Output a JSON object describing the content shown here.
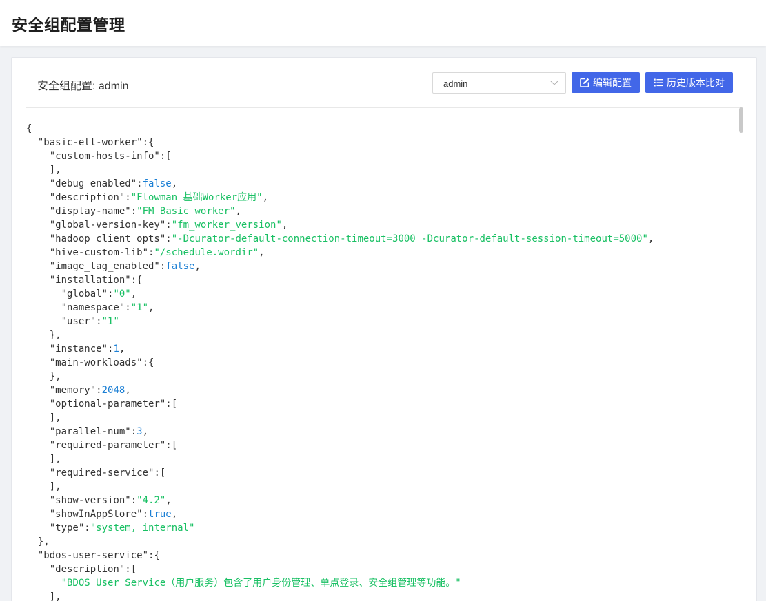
{
  "header": {
    "title": "安全组配置管理"
  },
  "card": {
    "label": "安全组配置: admin",
    "select": {
      "value": "admin"
    },
    "buttons": {
      "edit": "编辑配置",
      "history": "历史版本比对"
    }
  },
  "colors": {
    "accent": "#4267e8",
    "string": "#1ac064",
    "number": "#1b7fd4"
  },
  "code_lines": [
    [
      {
        "t": "p",
        "v": "{"
      }
    ],
    [
      {
        "t": "p",
        "v": "  "
      },
      {
        "t": "k",
        "v": "\"basic-etl-worker\""
      },
      {
        "t": "p",
        "v": ":{"
      }
    ],
    [
      {
        "t": "p",
        "v": "    "
      },
      {
        "t": "k",
        "v": "\"custom-hosts-info\""
      },
      {
        "t": "p",
        "v": ":["
      }
    ],
    [
      {
        "t": "p",
        "v": "    ],"
      }
    ],
    [
      {
        "t": "p",
        "v": "    "
      },
      {
        "t": "k",
        "v": "\"debug_enabled\""
      },
      {
        "t": "p",
        "v": ":"
      },
      {
        "t": "n",
        "v": "false"
      },
      {
        "t": "p",
        "v": ","
      }
    ],
    [
      {
        "t": "p",
        "v": "    "
      },
      {
        "t": "k",
        "v": "\"description\""
      },
      {
        "t": "p",
        "v": ":"
      },
      {
        "t": "s",
        "v": "\"Flowman 基础Worker应用\""
      },
      {
        "t": "p",
        "v": ","
      }
    ],
    [
      {
        "t": "p",
        "v": "    "
      },
      {
        "t": "k",
        "v": "\"display-name\""
      },
      {
        "t": "p",
        "v": ":"
      },
      {
        "t": "s",
        "v": "\"FM Basic worker\""
      },
      {
        "t": "p",
        "v": ","
      }
    ],
    [
      {
        "t": "p",
        "v": "    "
      },
      {
        "t": "k",
        "v": "\"global-version-key\""
      },
      {
        "t": "p",
        "v": ":"
      },
      {
        "t": "s",
        "v": "\"fm_worker_version\""
      },
      {
        "t": "p",
        "v": ","
      }
    ],
    [
      {
        "t": "p",
        "v": "    "
      },
      {
        "t": "k",
        "v": "\"hadoop_client_opts\""
      },
      {
        "t": "p",
        "v": ":"
      },
      {
        "t": "s",
        "v": "\"-Dcurator-default-connection-timeout=3000 -Dcurator-default-session-timeout=5000\""
      },
      {
        "t": "p",
        "v": ","
      }
    ],
    [
      {
        "t": "p",
        "v": "    "
      },
      {
        "t": "k",
        "v": "\"hive-custom-lib\""
      },
      {
        "t": "p",
        "v": ":"
      },
      {
        "t": "s",
        "v": "\"/schedule.wordir\""
      },
      {
        "t": "p",
        "v": ","
      }
    ],
    [
      {
        "t": "p",
        "v": "    "
      },
      {
        "t": "k",
        "v": "\"image_tag_enabled\""
      },
      {
        "t": "p",
        "v": ":"
      },
      {
        "t": "n",
        "v": "false"
      },
      {
        "t": "p",
        "v": ","
      }
    ],
    [
      {
        "t": "p",
        "v": "    "
      },
      {
        "t": "k",
        "v": "\"installation\""
      },
      {
        "t": "p",
        "v": ":{"
      }
    ],
    [
      {
        "t": "p",
        "v": "      "
      },
      {
        "t": "k",
        "v": "\"global\""
      },
      {
        "t": "p",
        "v": ":"
      },
      {
        "t": "s",
        "v": "\"0\""
      },
      {
        "t": "p",
        "v": ","
      }
    ],
    [
      {
        "t": "p",
        "v": "      "
      },
      {
        "t": "k",
        "v": "\"namespace\""
      },
      {
        "t": "p",
        "v": ":"
      },
      {
        "t": "s",
        "v": "\"1\""
      },
      {
        "t": "p",
        "v": ","
      }
    ],
    [
      {
        "t": "p",
        "v": "      "
      },
      {
        "t": "k",
        "v": "\"user\""
      },
      {
        "t": "p",
        "v": ":"
      },
      {
        "t": "s",
        "v": "\"1\""
      }
    ],
    [
      {
        "t": "p",
        "v": "    },"
      }
    ],
    [
      {
        "t": "p",
        "v": "    "
      },
      {
        "t": "k",
        "v": "\"instance\""
      },
      {
        "t": "p",
        "v": ":"
      },
      {
        "t": "n",
        "v": "1"
      },
      {
        "t": "p",
        "v": ","
      }
    ],
    [
      {
        "t": "p",
        "v": "    "
      },
      {
        "t": "k",
        "v": "\"main-workloads\""
      },
      {
        "t": "p",
        "v": ":{"
      }
    ],
    [
      {
        "t": "p",
        "v": "    },"
      }
    ],
    [
      {
        "t": "p",
        "v": "    "
      },
      {
        "t": "k",
        "v": "\"memory\""
      },
      {
        "t": "p",
        "v": ":"
      },
      {
        "t": "n",
        "v": "2048"
      },
      {
        "t": "p",
        "v": ","
      }
    ],
    [
      {
        "t": "p",
        "v": "    "
      },
      {
        "t": "k",
        "v": "\"optional-parameter\""
      },
      {
        "t": "p",
        "v": ":["
      }
    ],
    [
      {
        "t": "p",
        "v": "    ],"
      }
    ],
    [
      {
        "t": "p",
        "v": "    "
      },
      {
        "t": "k",
        "v": "\"parallel-num\""
      },
      {
        "t": "p",
        "v": ":"
      },
      {
        "t": "n",
        "v": "3"
      },
      {
        "t": "p",
        "v": ","
      }
    ],
    [
      {
        "t": "p",
        "v": "    "
      },
      {
        "t": "k",
        "v": "\"required-parameter\""
      },
      {
        "t": "p",
        "v": ":["
      }
    ],
    [
      {
        "t": "p",
        "v": "    ],"
      }
    ],
    [
      {
        "t": "p",
        "v": "    "
      },
      {
        "t": "k",
        "v": "\"required-service\""
      },
      {
        "t": "p",
        "v": ":["
      }
    ],
    [
      {
        "t": "p",
        "v": "    ],"
      }
    ],
    [
      {
        "t": "p",
        "v": "    "
      },
      {
        "t": "k",
        "v": "\"show-version\""
      },
      {
        "t": "p",
        "v": ":"
      },
      {
        "t": "s",
        "v": "\"4.2\""
      },
      {
        "t": "p",
        "v": ","
      }
    ],
    [
      {
        "t": "p",
        "v": "    "
      },
      {
        "t": "k",
        "v": "\"showInAppStore\""
      },
      {
        "t": "p",
        "v": ":"
      },
      {
        "t": "n",
        "v": "true"
      },
      {
        "t": "p",
        "v": ","
      }
    ],
    [
      {
        "t": "p",
        "v": "    "
      },
      {
        "t": "k",
        "v": "\"type\""
      },
      {
        "t": "p",
        "v": ":"
      },
      {
        "t": "s",
        "v": "\"system, internal\""
      }
    ],
    [
      {
        "t": "p",
        "v": "  },"
      }
    ],
    [
      {
        "t": "p",
        "v": "  "
      },
      {
        "t": "k",
        "v": "\"bdos-user-service\""
      },
      {
        "t": "p",
        "v": ":{"
      }
    ],
    [
      {
        "t": "p",
        "v": "    "
      },
      {
        "t": "k",
        "v": "\"description\""
      },
      {
        "t": "p",
        "v": ":["
      }
    ],
    [
      {
        "t": "p",
        "v": "      "
      },
      {
        "t": "s",
        "v": "\"BDOS User Service（用户服务）包含了用户身份管理、单点登录、安全组管理等功能。\""
      }
    ],
    [
      {
        "t": "p",
        "v": "    ],"
      }
    ]
  ]
}
